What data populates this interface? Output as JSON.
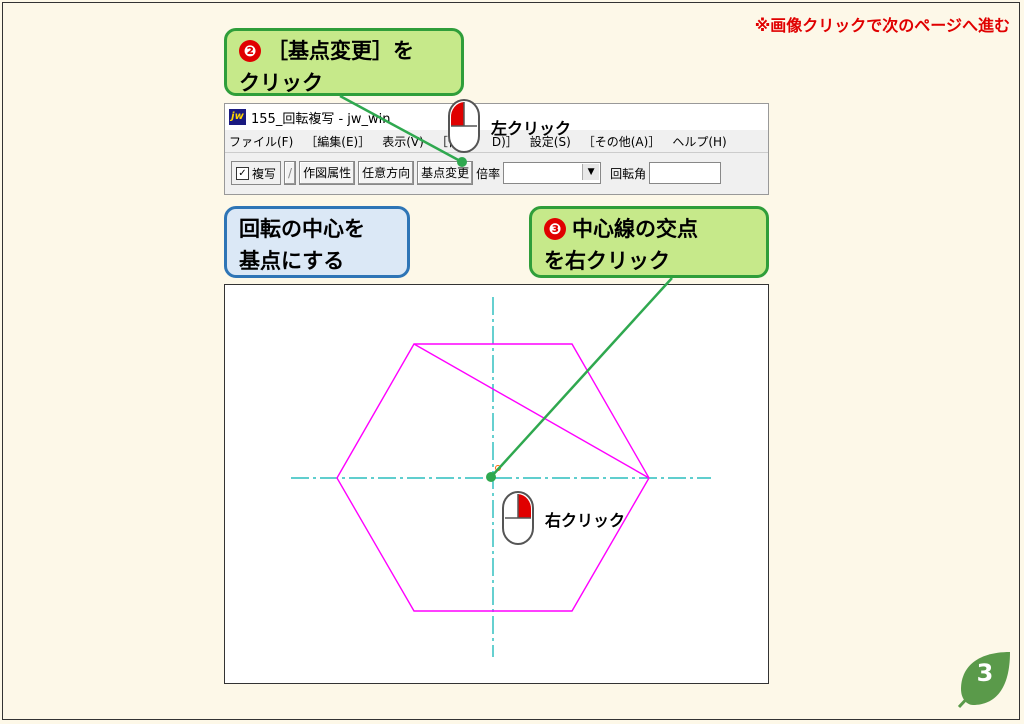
{
  "nav_hint": "※画像クリックで次のページへ進む",
  "callout_step2": {
    "num": "❷",
    "text": "［基点変更］を",
    "line2": "クリック"
  },
  "callout_info": {
    "line1": "回転の中心を",
    "line2": "基点にする"
  },
  "callout_step3": {
    "num": "❸",
    "text": "中心線の交点",
    "line2": "を右クリック"
  },
  "window": {
    "title": "155_回転複写 - jw_win",
    "logo": "jw",
    "menu": [
      "ファイル(F)",
      "［編集(E)］",
      "表示(V)",
      "［作",
      "D)］",
      "設定(S)",
      "［その他(A)］",
      "ヘルプ(H)"
    ],
    "toolbar": {
      "copy_check": "✓",
      "copy_label": "複写",
      "slash": "/",
      "btn_attr": "作図属性",
      "btn_dir": "任意方向",
      "btn_base": "基点変更",
      "ratio_label": "倍率",
      "angle_label": "回転角"
    }
  },
  "mouse_top_label": "左クリック",
  "mouse_canvas_label": "右クリック",
  "page_number": "3",
  "colors": {
    "hexagon": "#ff00ff",
    "centerline": "#00b0b0",
    "pointer": "#2fa84f"
  }
}
